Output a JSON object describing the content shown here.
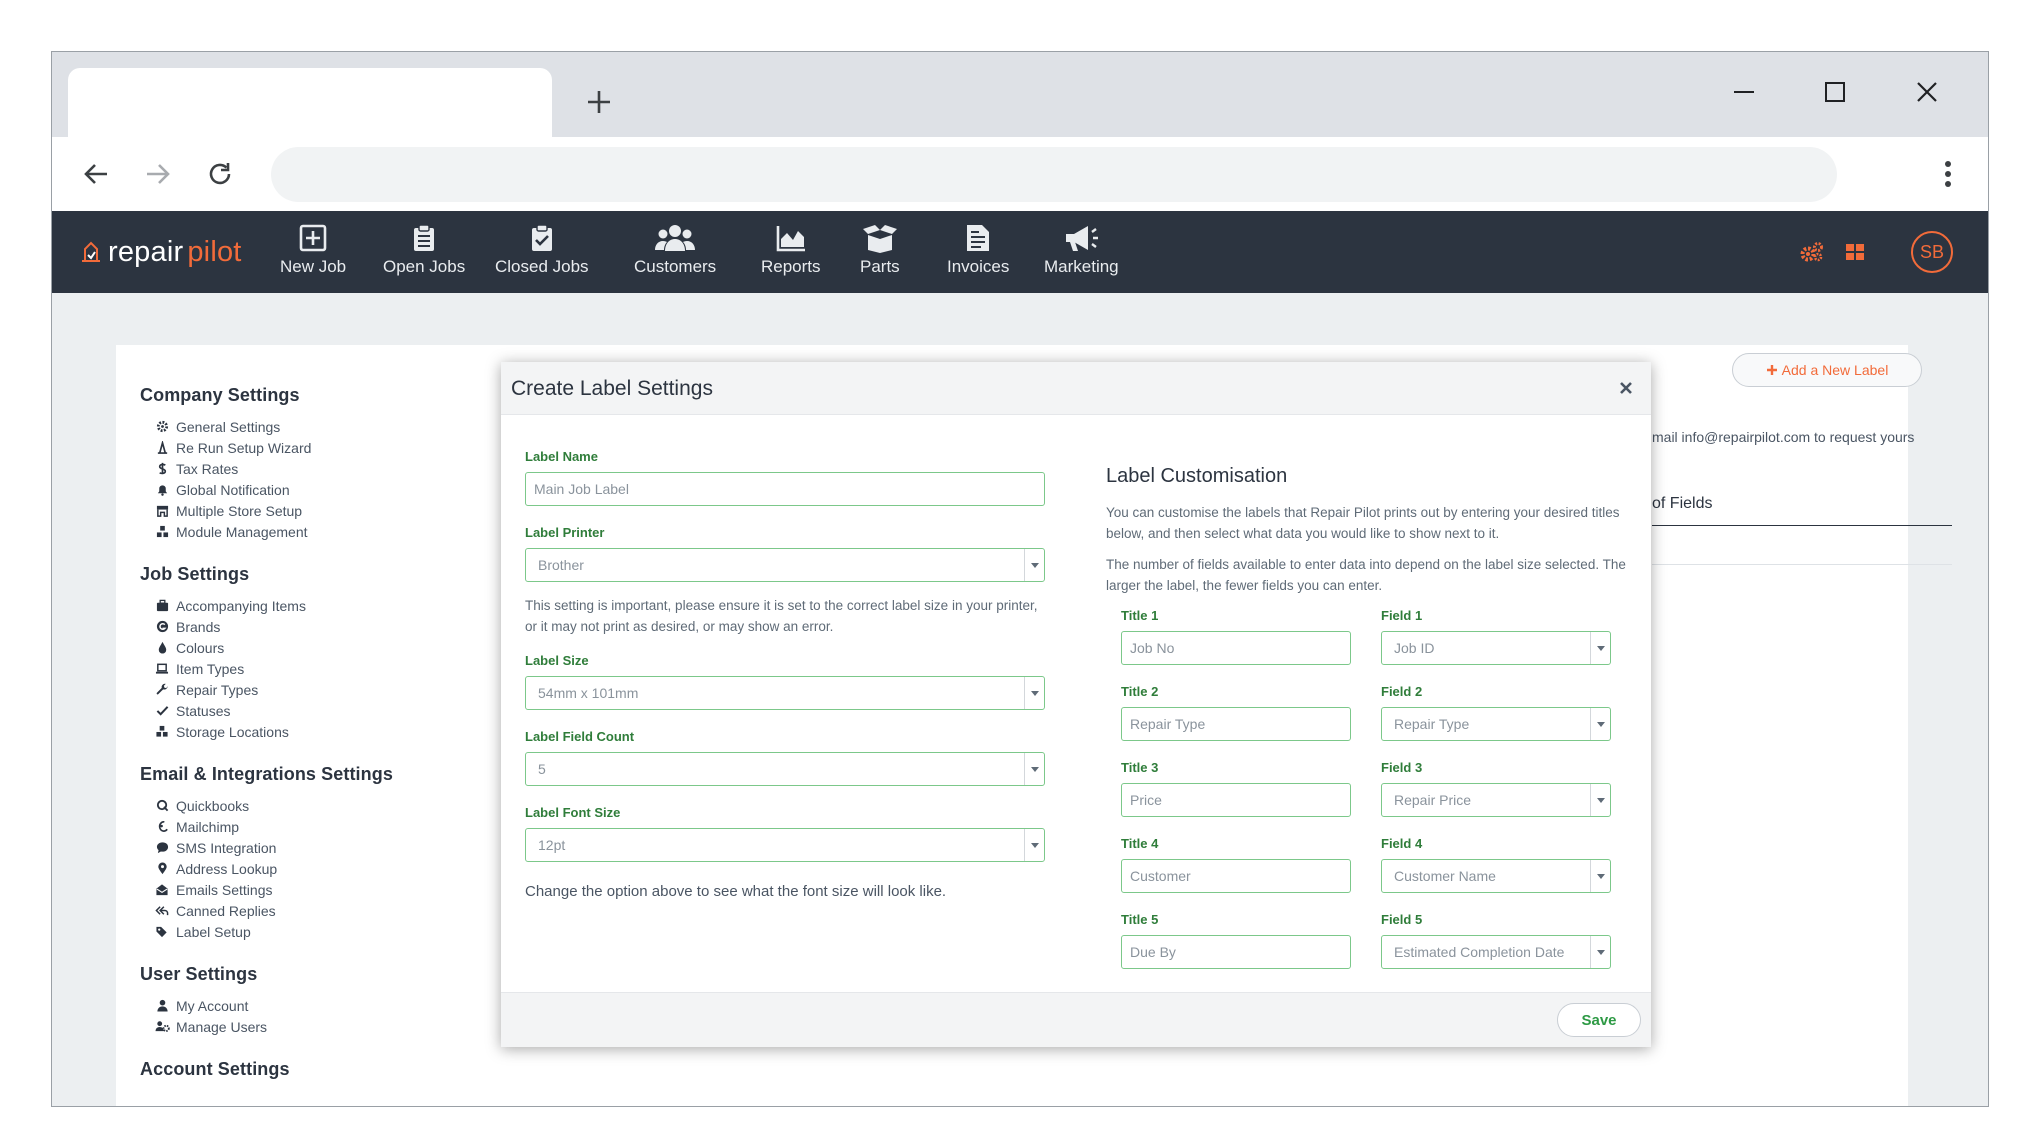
{
  "app": {
    "logo_repair": "repair",
    "logo_pilot": "pilot",
    "nav": [
      {
        "label": "New Job",
        "icon": "plus-square-icon"
      },
      {
        "label": "Open Jobs",
        "icon": "clipboard-list-icon"
      },
      {
        "label": "Closed Jobs",
        "icon": "clipboard-check-icon"
      },
      {
        "label": "Customers",
        "icon": "users-icon"
      },
      {
        "label": "Reports",
        "icon": "area-chart-icon"
      },
      {
        "label": "Parts",
        "icon": "box-open-icon"
      },
      {
        "label": "Invoices",
        "icon": "file-invoice-icon"
      },
      {
        "label": "Marketing",
        "icon": "megaphone-icon"
      }
    ],
    "avatar_initials": "SB",
    "accent_color": "#f26b3a"
  },
  "sidebar": {
    "sections": [
      {
        "title": "Company Settings",
        "items": [
          {
            "label": "General Settings",
            "icon": "gear-icon"
          },
          {
            "label": "Re Run Setup Wizard",
            "icon": "wizard-icon"
          },
          {
            "label": "Tax Rates",
            "icon": "dollar-icon"
          },
          {
            "label": "Global Notification",
            "icon": "bell-icon"
          },
          {
            "label": "Multiple Store Setup",
            "icon": "store-icon"
          },
          {
            "label": "Module Management",
            "icon": "cubes-icon"
          }
        ]
      },
      {
        "title": "Job Settings",
        "items": [
          {
            "label": "Accompanying Items",
            "icon": "briefcase-icon"
          },
          {
            "label": "Brands",
            "icon": "brand-icon"
          },
          {
            "label": "Colours",
            "icon": "droplet-icon"
          },
          {
            "label": "Item Types",
            "icon": "laptop-icon"
          },
          {
            "label": "Repair Types",
            "icon": "wrench-icon"
          },
          {
            "label": "Statuses",
            "icon": "check-icon"
          },
          {
            "label": "Storage Locations",
            "icon": "boxes-icon"
          }
        ]
      },
      {
        "title": "Email & Integrations Settings",
        "items": [
          {
            "label": "Quickbooks",
            "icon": "quickbooks-icon"
          },
          {
            "label": "Mailchimp",
            "icon": "mailchimp-icon"
          },
          {
            "label": "SMS Integration",
            "icon": "sms-icon"
          },
          {
            "label": "Address Lookup",
            "icon": "map-pin-icon"
          },
          {
            "label": "Emails Settings",
            "icon": "envelope-open-icon"
          },
          {
            "label": "Canned Replies",
            "icon": "reply-all-icon"
          },
          {
            "label": "Label Setup",
            "icon": "tags-icon"
          }
        ]
      },
      {
        "title": "User Settings",
        "items": [
          {
            "label": "My Account",
            "icon": "user-icon"
          },
          {
            "label": "Manage Users",
            "icon": "users-cog-icon"
          }
        ]
      },
      {
        "title": "Account Settings",
        "items": []
      }
    ]
  },
  "background": {
    "add_label_button": "Add a New Label",
    "email_hint": "mail info@repairpilot.com to request yours",
    "fields_header": "of Fields"
  },
  "modal": {
    "title": "Create Label Settings",
    "label_name": {
      "label": "Label Name",
      "value": "Main Job Label"
    },
    "label_printer": {
      "label": "Label Printer",
      "value": "Brother"
    },
    "printer_help": "This setting is important, please ensure it is set to the correct label size in your printer, or it may not print as desired, or may show an error.",
    "label_size": {
      "label": "Label Size",
      "value": "54mm x 101mm"
    },
    "label_field_count": {
      "label": "Label Field Count",
      "value": "5"
    },
    "label_font_size": {
      "label": "Label Font Size",
      "value": "12pt"
    },
    "font_help": "Change the option above to see what the font size will look like.",
    "customisation": {
      "title": "Label Customisation",
      "text1": "You can customise the labels that Repair Pilot prints out by entering your desired titles below, and then select what data you would like to show next to it.",
      "text2": "The number of fields available to enter data into depend on the label size selected. The larger the label, the fewer fields you can enter.",
      "rows": [
        {
          "title_label": "Title 1",
          "title_value": "Job No",
          "field_label": "Field 1",
          "field_value": "Job ID"
        },
        {
          "title_label": "Title 2",
          "title_value": "Repair Type",
          "field_label": "Field 2",
          "field_value": "Repair Type"
        },
        {
          "title_label": "Title 3",
          "title_value": "Price",
          "field_label": "Field 3",
          "field_value": "Repair Price"
        },
        {
          "title_label": "Title 4",
          "title_value": "Customer",
          "field_label": "Field 4",
          "field_value": "Customer Name"
        },
        {
          "title_label": "Title 5",
          "title_value": "Due By",
          "field_label": "Field 5",
          "field_value": "Estimated Completion Date"
        }
      ]
    },
    "save_label": "Save"
  }
}
